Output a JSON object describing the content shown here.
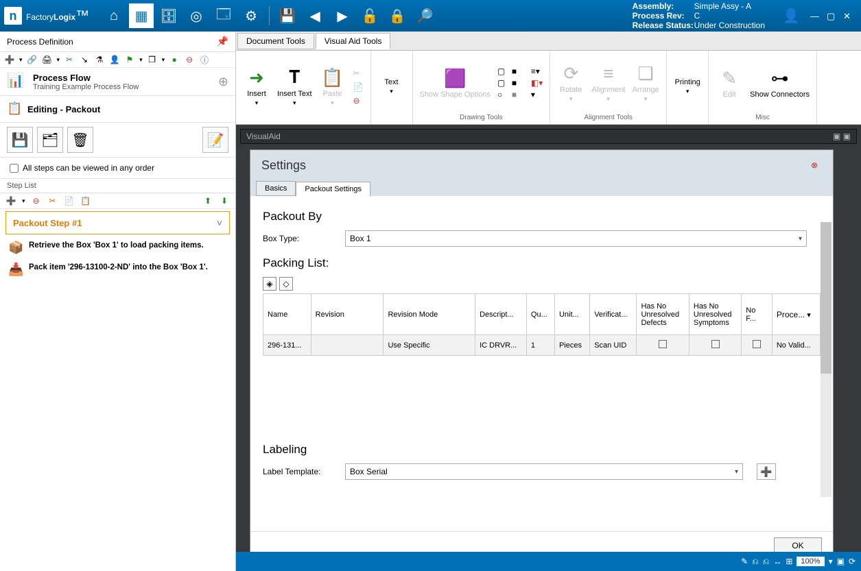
{
  "app": {
    "brand_left": "Factory",
    "brand_right": "Logix"
  },
  "header_info": {
    "assembly_lbl": "Assembly:",
    "assembly": "Simple Assy - A",
    "rev_lbl": "Process Rev:",
    "rev": "C",
    "status_lbl": "Release Status:",
    "status": "Under Construction"
  },
  "left": {
    "title": "Process Definition",
    "flow_title": "Process Flow",
    "flow_sub": "Training Example Process Flow",
    "editing": "Editing - Packout",
    "anyorder": "All steps can be viewed in any order",
    "steplist": "Step List",
    "selected_step": "Packout Step #1",
    "step_items": [
      "Retrieve the Box 'Box 1' to load packing items.",
      "Pack item '296-13100-2-ND' into the Box 'Box 1'."
    ]
  },
  "tabs": {
    "doc": "Document Tools",
    "va": "Visual Aid Tools"
  },
  "ribbon": {
    "insert": "Insert",
    "insert_text": "Insert Text",
    "paste": "Paste",
    "text": "Text",
    "show_shape": "Show Shape Options",
    "drawing": "Drawing Tools",
    "rotate": "Rotate",
    "align": "Alignment",
    "arrange": "Arrange",
    "alignment_tools": "Alignment Tools",
    "printing": "Printing",
    "edit": "Edit",
    "show_conn": "Show Connectors",
    "misc": "Misc"
  },
  "va_lbl": "VisualAid",
  "dialog": {
    "title": "Settings",
    "tab_basics": "Basics",
    "tab_packout": "Packout Settings",
    "packout_by": "Packout By",
    "box_type_lbl": "Box Type:",
    "box_type": "Box 1",
    "packing_list": "Packing List:",
    "cols": [
      "Name",
      "Revision",
      "Revision Mode",
      "Descript...",
      "Qu...",
      "Unit...",
      "Verificat...",
      "Has No Unresolved Defects",
      "Has No Unresolved Symptoms",
      "No F...",
      "Proce..."
    ],
    "row": {
      "name": "296-131...",
      "revision": "",
      "rev_mode": "Use Specific",
      "desc": "IC DRVR...",
      "qty": "1",
      "unit": "Pieces",
      "verif": "Scan UID",
      "proc": "No Valid..."
    },
    "labeling": "Labeling",
    "label_tpl_lbl": "Label Template:",
    "label_tpl": "Box Serial",
    "ok": "OK"
  },
  "zoom": "100%"
}
